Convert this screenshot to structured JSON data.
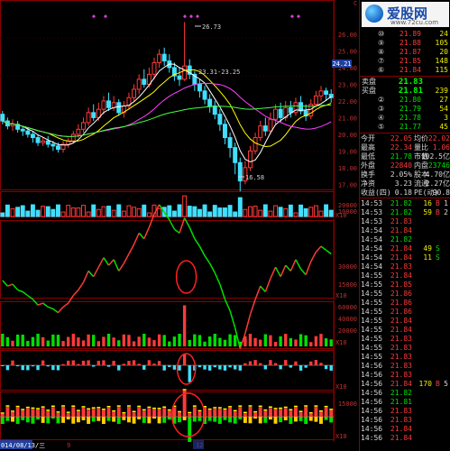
{
  "logo": {
    "name": "爱股网",
    "url": "www.72cu.com"
  },
  "main_chart": {
    "price_axis": [
      "26.00",
      "25.00",
      "24.00",
      "23.00",
      "22.00",
      "21.00",
      "20.00",
      "19.00",
      "18.00",
      "17.00"
    ],
    "price_marker": "24.21",
    "annotations": {
      "high": "26.73",
      "mid": "23.31-23.25",
      "low": "16.58"
    },
    "corner": "C"
  },
  "volume_panel": {
    "axis": [
      "20000",
      "10000"
    ],
    "unit": "X10"
  },
  "obv_panel": {
    "axis": [
      "30000",
      "15000"
    ],
    "unit": "X10"
  },
  "big_order_panel": {
    "axis": [
      "60000",
      "40000",
      "20000"
    ],
    "unit": "X10"
  },
  "diff_panel": {
    "unit": "X10"
  },
  "net_panel": {
    "axis": [
      "15000"
    ],
    "unit": "X10"
  },
  "date_axis": {
    "start_label": "014/08/13/三",
    "ticks": [
      "9",
      "12"
    ]
  },
  "order_book": {
    "sell": [
      {
        "level": "⑩",
        "price": "21.89",
        "vol": "24"
      },
      {
        "level": "⑨",
        "price": "21.88",
        "vol": "105"
      },
      {
        "level": "⑧",
        "price": "21.87",
        "vol": "20"
      },
      {
        "level": "⑦",
        "price": "21.85",
        "vol": "148"
      },
      {
        "level": "⑥",
        "price": "21.84",
        "vol": "115"
      }
    ],
    "sell_total": {
      "label": "卖盘",
      "price": "21.83",
      "vol": ""
    },
    "buy_total": {
      "label": "买盘",
      "price": "21.81",
      "vol": "239"
    },
    "buy": [
      {
        "level": "②",
        "price": "21.80",
        "vol": "27"
      },
      {
        "level": "③",
        "price": "21.79",
        "vol": "54"
      },
      {
        "level": "④",
        "price": "21.78",
        "vol": "3"
      },
      {
        "level": "⑤",
        "price": "21.77",
        "vol": "45"
      }
    ]
  },
  "stats": [
    {
      "l1": "今开",
      "v1": "22.05",
      "l2": "均价",
      "v2": "22.02"
    },
    {
      "l1": "最高",
      "v1": "22.34",
      "l2": "量比",
      "v2": "1.06"
    },
    {
      "l1": "最低",
      "v1": "21.78",
      "l2": "市值",
      "v2": "102.5亿"
    },
    {
      "l1": "外盘",
      "v1": "22840",
      "l2": "内盘",
      "v2": "23746"
    },
    {
      "l1": "换手",
      "v1": "2.05%",
      "l2": "股本",
      "v2": "4.70亿"
    },
    {
      "l1": "净资",
      "v1": "3.23",
      "l2": "流通",
      "v2": "2.27亿"
    },
    {
      "l1": "收益(四)",
      "v1": "0.18",
      "l2": "PE(动)",
      "v2": "90.8"
    }
  ],
  "ticks": [
    {
      "t": "14:53",
      "p": "21.82",
      "v": "16",
      "s": "B",
      "f": "1"
    },
    {
      "t": "14:53",
      "p": "21.82",
      "v": "59",
      "s": "B",
      "f": "2"
    },
    {
      "t": "14:53",
      "p": "21.83",
      "v": "",
      "s": "",
      "f": ""
    },
    {
      "t": "14:54",
      "p": "21.84",
      "v": "",
      "s": "",
      "f": ""
    },
    {
      "t": "14:54",
      "p": "21.82",
      "v": "",
      "s": "",
      "f": ""
    },
    {
      "t": "14:54",
      "p": "21.84",
      "v": "49",
      "s": "S",
      "f": ""
    },
    {
      "t": "14:54",
      "p": "21.84",
      "v": "11",
      "s": "S",
      "f": ""
    },
    {
      "t": "14:54",
      "p": "21.83",
      "v": "",
      "s": "",
      "f": ""
    },
    {
      "t": "14:55",
      "p": "21.84",
      "v": "",
      "s": "",
      "f": ""
    },
    {
      "t": "14:55",
      "p": "21.85",
      "v": "",
      "s": "",
      "f": ""
    },
    {
      "t": "14:55",
      "p": "21.86",
      "v": "",
      "s": "",
      "f": ""
    },
    {
      "t": "14:55",
      "p": "21.86",
      "v": "",
      "s": "",
      "f": ""
    },
    {
      "t": "14:55",
      "p": "21.86",
      "v": "",
      "s": "",
      "f": ""
    },
    {
      "t": "14:55",
      "p": "21.84",
      "v": "",
      "s": "",
      "f": ""
    },
    {
      "t": "14:55",
      "p": "21.84",
      "v": "",
      "s": "",
      "f": ""
    },
    {
      "t": "14:55",
      "p": "21.83",
      "v": "",
      "s": "",
      "f": ""
    },
    {
      "t": "14:55",
      "p": "21.83",
      "v": "",
      "s": "",
      "f": ""
    },
    {
      "t": "14:55",
      "p": "21.83",
      "v": "",
      "s": "",
      "f": ""
    },
    {
      "t": "14:56",
      "p": "21.83",
      "v": "",
      "s": "",
      "f": ""
    },
    {
      "t": "14:56",
      "p": "21.83",
      "v": "",
      "s": "",
      "f": ""
    },
    {
      "t": "14:56",
      "p": "21.84",
      "v": "170",
      "s": "B",
      "f": "5"
    },
    {
      "t": "14:56",
      "p": "21.82",
      "v": "",
      "s": "",
      "f": ""
    },
    {
      "t": "14:56",
      "p": "21.81",
      "v": "",
      "s": "",
      "f": ""
    },
    {
      "t": "14:56",
      "p": "21.83",
      "v": "",
      "s": "",
      "f": ""
    },
    {
      "t": "14:56",
      "p": "21.83",
      "v": "",
      "s": "",
      "f": ""
    },
    {
      "t": "14:56",
      "p": "21.84",
      "v": "",
      "s": "",
      "f": ""
    },
    {
      "t": "14:56",
      "p": "21.84",
      "v": "",
      "s": "",
      "f": ""
    },
    {
      "t": "14:56",
      "p": "21.84",
      "v": "",
      "s": "",
      "f": ""
    },
    {
      "t": "14:56",
      "p": "21.83",
      "v": "",
      "s": "",
      "f": ""
    },
    {
      "t": "15:00",
      "p": "21.81",
      "v": "255",
      "s": "",
      "f": ""
    }
  ],
  "colors": {
    "up": "#ff3a3a",
    "down": "#00e000",
    "bg": "#000000",
    "grid": "#8a0000",
    "cyan": "#40e0ff"
  }
}
